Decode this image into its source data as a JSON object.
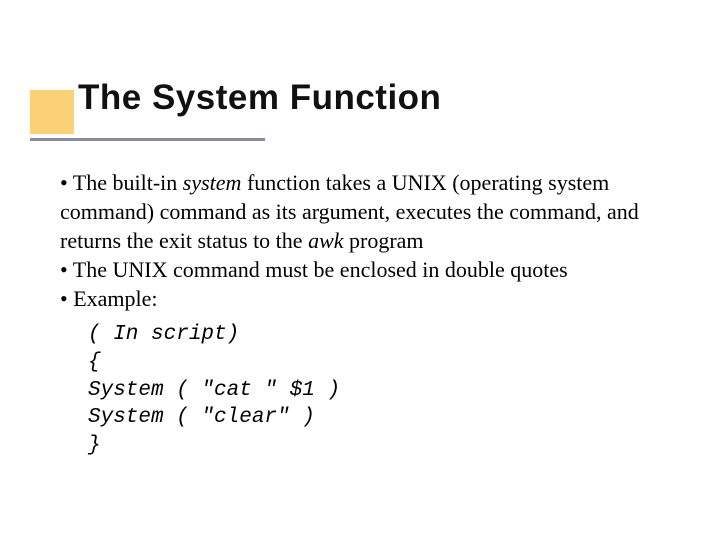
{
  "title": "The System Function",
  "bullets": {
    "b1_pre": " • The built-in ",
    "b1_em1": "system",
    "b1_mid": " function takes a UNIX (operating system command) command as its argument, executes the command, and returns the exit status to the ",
    "b1_em2": "awk",
    "b1_post": " program",
    "b2": " • The UNIX command must be enclosed in double quotes",
    "b3": " • Example:"
  },
  "code": {
    "l1": "( In script)",
    "l2": "{",
    "l3": "System ( \"cat \" $1 )",
    "l4": "System ( \"clear\" )",
    "l5": "}"
  }
}
